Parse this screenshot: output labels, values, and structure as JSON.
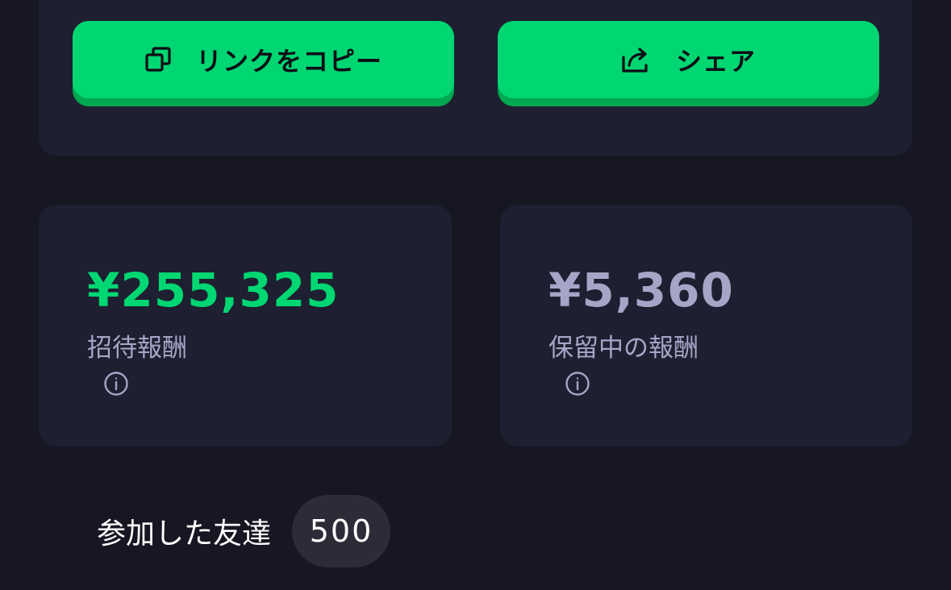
{
  "share_panel": {
    "copy_button": {
      "label": "リンクをコピー",
      "icon": "copy-icon"
    },
    "share_button": {
      "label": "シェア",
      "icon": "share-icon"
    }
  },
  "rewards": {
    "earned": {
      "amount": "¥255,325",
      "label": "招待報酬",
      "info_icon": "info-icon",
      "color": "#00d672"
    },
    "pending": {
      "amount": "¥5,360",
      "label": "保留中の報酬",
      "info_icon": "info-icon",
      "color": "#a7a5c7"
    }
  },
  "friends": {
    "label": "参加した友達",
    "count": "500"
  },
  "colors": {
    "background": "#161722",
    "card": "#1e1f30",
    "accent": "#00d672",
    "accent_shadow": "#00a84f"
  }
}
